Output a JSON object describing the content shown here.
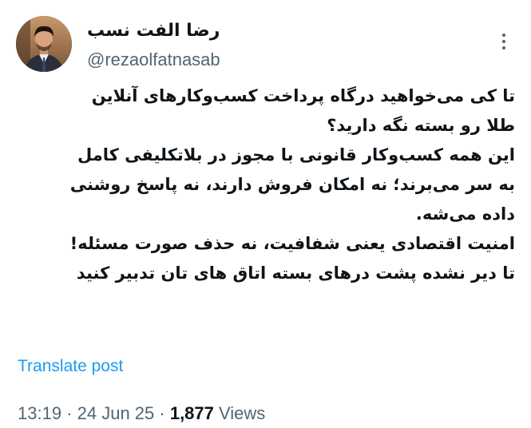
{
  "author": {
    "display_name": "رضا الفت نسب",
    "handle": "@rezaolfatnasab",
    "avatar_icon": "person-avatar-photo"
  },
  "tweet": {
    "lines": [
      "تا کی می‌خواهید درگاه پرداخت کسب‌وکارهای آنلاین",
      "طلا رو بسته نگه دارید؟",
      "این همه کسب‌وکار قانونی با مجوز در بلاتکلیفی کامل",
      "به سر می‌برند؛ نه امکان فروش دارند، نه پاسخ روشنی",
      "داده می‌شه.",
      "امنیت اقتصادی یعنی شفافیت، نه حذف صورت مسئله!",
      "تا دیر نشده پشت درهای بسته اتاق های تان تدبیر کنید"
    ],
    "translate_label": "Translate post"
  },
  "meta": {
    "time": "13:19",
    "separator": " · ",
    "date": "24 Jun 25",
    "views_count": "1,877",
    "views_label": " Views"
  },
  "colors": {
    "text": "#0f1419",
    "secondary": "#536471",
    "link": "#1d9bf0"
  }
}
